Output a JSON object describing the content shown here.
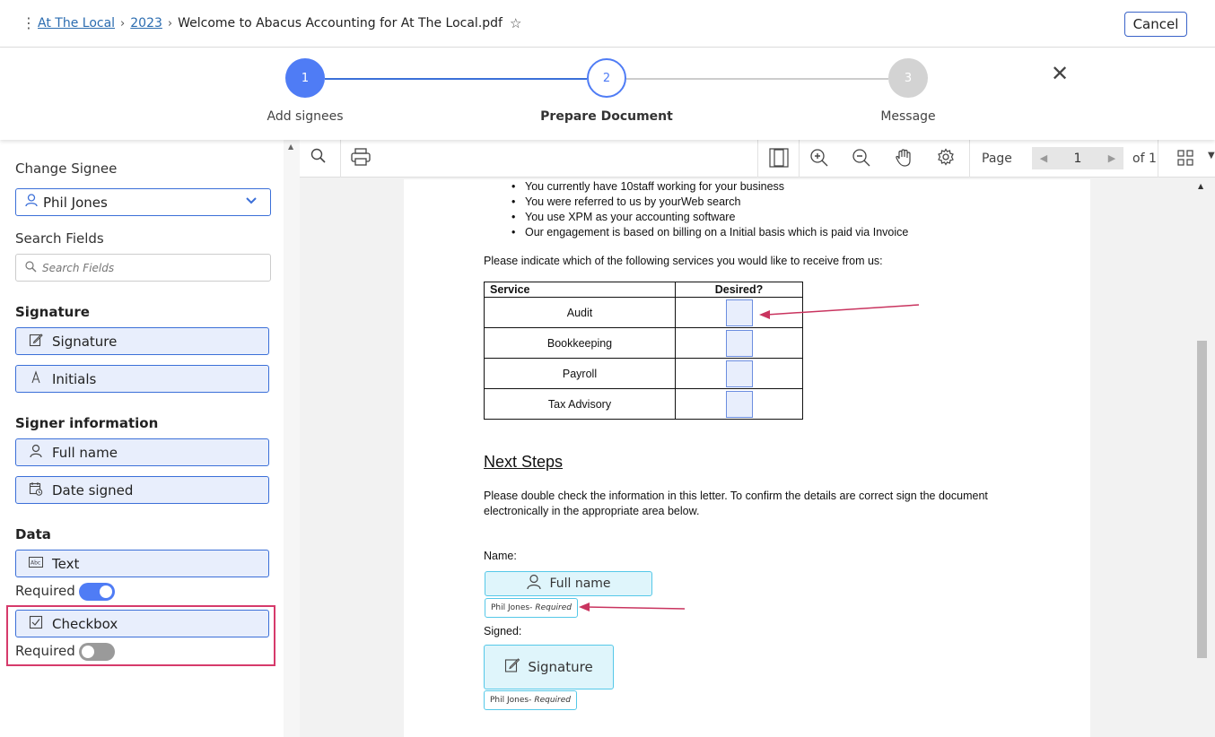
{
  "breadcrumb": {
    "items": [
      "At The Local",
      "2023"
    ],
    "document": "Welcome to Abacus Accounting for At The Local.pdf"
  },
  "header": {
    "cancel_label": "Cancel"
  },
  "stepper": {
    "steps": [
      {
        "number": "1",
        "label": "Add signees",
        "state": "completed"
      },
      {
        "number": "2",
        "label": "Prepare Document",
        "state": "active"
      },
      {
        "number": "3",
        "label": "Message",
        "state": "pending"
      }
    ]
  },
  "sidebar": {
    "change_signee_label": "Change Signee",
    "signee_value": "Phil Jones",
    "search_label": "Search Fields",
    "search_placeholder": "Search Fields",
    "sections": {
      "signature": "Signature",
      "signer_info": "Signer information",
      "data": "Data"
    },
    "fields": {
      "signature": "Signature",
      "initials": "Initials",
      "full_name": "Full name",
      "date_signed": "Date signed",
      "text": "Text",
      "checkbox": "Checkbox"
    },
    "required_label": "Required",
    "text_required": true,
    "checkbox_required": false
  },
  "viewer": {
    "page_label": "Page",
    "page_current": "1",
    "page_total_label": "of 1"
  },
  "document": {
    "bullets": [
      "You currently have 10staff working for your business",
      "You were referred to us by yourWeb search",
      "You use XPM as your accounting software",
      "Our engagement is based on billing on a Initial basis which is paid via Invoice"
    ],
    "services_intro": "Please indicate which of the following services you would like to receive from us:",
    "table_headers": [
      "Service",
      "Desired?"
    ],
    "services": [
      "Audit",
      "Bookkeeping",
      "Payroll",
      "Tax Advisory"
    ],
    "next_steps_heading": "Next Steps",
    "next_steps_text_1": "Please double check the information in this letter. To confirm the details are correct sign the document",
    "next_steps_text_2": "electronically in the appropriate area below.",
    "name_label": "Name:",
    "signed_label": "Signed:",
    "full_name_field": "Full name",
    "signature_field": "Signature",
    "signee_tag": "Phil Jones-",
    "required_tag": "Required"
  },
  "colors": {
    "primary": "#4f7cf5",
    "highlight": "#d63a6b",
    "arrow": "#c9345f"
  }
}
